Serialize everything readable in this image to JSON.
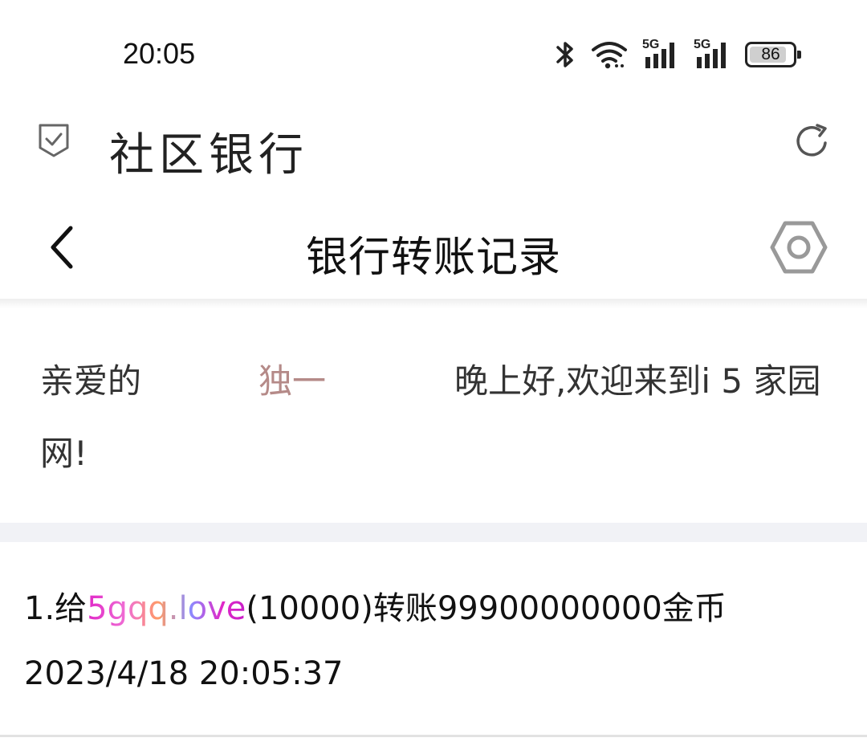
{
  "status_bar": {
    "time": "20:05",
    "network_1": "5G",
    "network_2": "5G",
    "battery_level": "86",
    "battery_percent": 86
  },
  "app": {
    "title": "社区银行"
  },
  "nav": {
    "page_title": "银行转账记录"
  },
  "greeting": {
    "prefix": "亲爱的",
    "username": "独一",
    "message": "晚上好,欢迎来到i 5 家园网!",
    "username_color": "#b58a88"
  },
  "records": [
    {
      "index": "1.",
      "to_label": "给",
      "recipient": "5gqq.love",
      "recipient_id": "(10000)",
      "action": "转账",
      "amount": "99900000000",
      "unit": "金币",
      "time": "2023/4/18 20:05:37"
    }
  ],
  "colors": {
    "divider_band": "#f1f2f6",
    "text": "#111111"
  }
}
